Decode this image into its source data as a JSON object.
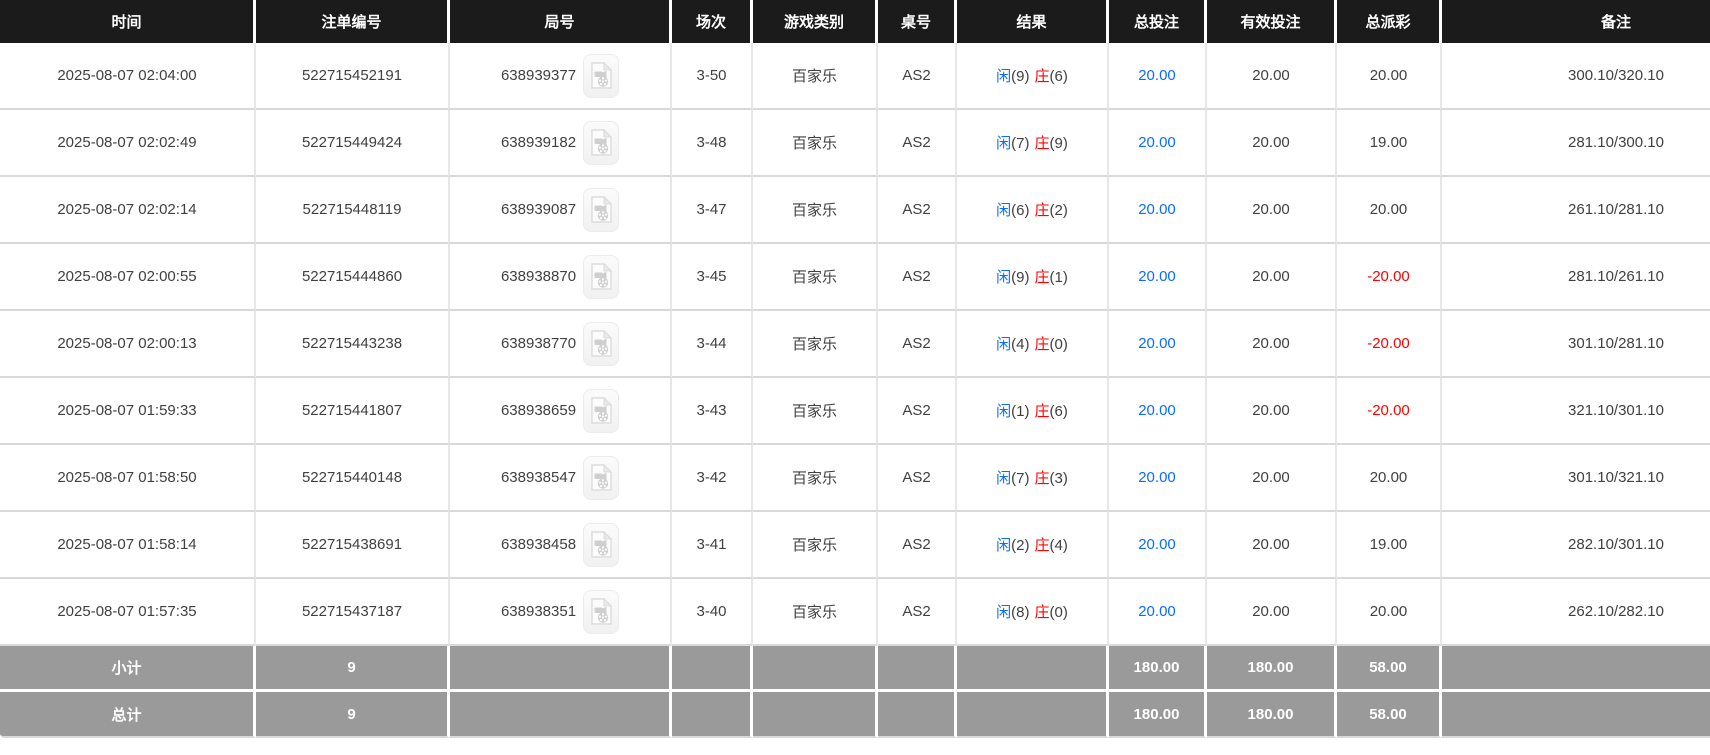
{
  "colors": {
    "header_bg": "#1b1b1b",
    "header_text": "#ffffff",
    "summary_bg": "#9a9a9a",
    "row_bg": "#ffffff",
    "text": "#404040",
    "blue_accent": "#0b6cff",
    "red_accent": "#ff0000",
    "grid_line": "#d9d9d9"
  },
  "table": {
    "headers": [
      "时间",
      "注单编号",
      "局号",
      "场次",
      "游戏类别",
      "桌号",
      "结果",
      "总投注",
      "有效投注",
      "总派彩",
      "备注"
    ],
    "rows": [
      {
        "time": "2025-08-07 02:04:00",
        "bet_no": "522715452191",
        "round_no": "638939377",
        "session": "3-50",
        "game": "百家乐",
        "table_no": "AS2",
        "player_label": "闲",
        "player_score": "(9)",
        "banker_label": "庄",
        "banker_score": "(6)",
        "total_bet": "20.00",
        "valid_bet": "20.00",
        "payout": "20.00",
        "remark": "300.10/320.10"
      },
      {
        "time": "2025-08-07 02:02:49",
        "bet_no": "522715449424",
        "round_no": "638939182",
        "session": "3-48",
        "game": "百家乐",
        "table_no": "AS2",
        "player_label": "闲",
        "player_score": "(7)",
        "banker_label": "庄",
        "banker_score": "(9)",
        "total_bet": "20.00",
        "valid_bet": "20.00",
        "payout": "19.00",
        "remark": "281.10/300.10"
      },
      {
        "time": "2025-08-07 02:02:14",
        "bet_no": "522715448119",
        "round_no": "638939087",
        "session": "3-47",
        "game": "百家乐",
        "table_no": "AS2",
        "player_label": "闲",
        "player_score": "(6)",
        "banker_label": "庄",
        "banker_score": "(2)",
        "total_bet": "20.00",
        "valid_bet": "20.00",
        "payout": "20.00",
        "remark": "261.10/281.10"
      },
      {
        "time": "2025-08-07 02:00:55",
        "bet_no": "522715444860",
        "round_no": "638938870",
        "session": "3-45",
        "game": "百家乐",
        "table_no": "AS2",
        "player_label": "闲",
        "player_score": "(9)",
        "banker_label": "庄",
        "banker_score": "(1)",
        "total_bet": "20.00",
        "valid_bet": "20.00",
        "payout": "-20.00",
        "remark": "281.10/261.10"
      },
      {
        "time": "2025-08-07 02:00:13",
        "bet_no": "522715443238",
        "round_no": "638938770",
        "session": "3-44",
        "game": "百家乐",
        "table_no": "AS2",
        "player_label": "闲",
        "player_score": "(4)",
        "banker_label": "庄",
        "banker_score": "(0)",
        "total_bet": "20.00",
        "valid_bet": "20.00",
        "payout": "-20.00",
        "remark": "301.10/281.10"
      },
      {
        "time": "2025-08-07 01:59:33",
        "bet_no": "522715441807",
        "round_no": "638938659",
        "session": "3-43",
        "game": "百家乐",
        "table_no": "AS2",
        "player_label": "闲",
        "player_score": "(1)",
        "banker_label": "庄",
        "banker_score": "(6)",
        "total_bet": "20.00",
        "valid_bet": "20.00",
        "payout": "-20.00",
        "remark": "321.10/301.10"
      },
      {
        "time": "2025-08-07 01:58:50",
        "bet_no": "522715440148",
        "round_no": "638938547",
        "session": "3-42",
        "game": "百家乐",
        "table_no": "AS2",
        "player_label": "闲",
        "player_score": "(7)",
        "banker_label": "庄",
        "banker_score": "(3)",
        "total_bet": "20.00",
        "valid_bet": "20.00",
        "payout": "20.00",
        "remark": "301.10/321.10"
      },
      {
        "time": "2025-08-07 01:58:14",
        "bet_no": "522715438691",
        "round_no": "638938458",
        "session": "3-41",
        "game": "百家乐",
        "table_no": "AS2",
        "player_label": "闲",
        "player_score": "(2)",
        "banker_label": "庄",
        "banker_score": "(4)",
        "total_bet": "20.00",
        "valid_bet": "20.00",
        "payout": "19.00",
        "remark": "282.10/301.10"
      },
      {
        "time": "2025-08-07 01:57:35",
        "bet_no": "522715437187",
        "round_no": "638938351",
        "session": "3-40",
        "game": "百家乐",
        "table_no": "AS2",
        "player_label": "闲",
        "player_score": "(8)",
        "banker_label": "庄",
        "banker_score": "(0)",
        "total_bet": "20.00",
        "valid_bet": "20.00",
        "payout": "20.00",
        "remark": "262.10/282.10"
      }
    ],
    "subtotal": {
      "label": "小计",
      "count": "9",
      "total_bet": "180.00",
      "valid_bet": "180.00",
      "payout": "58.00"
    },
    "grand_total": {
      "label": "总计",
      "count": "9",
      "total_bet": "180.00",
      "valid_bet": "180.00",
      "payout": "58.00"
    }
  },
  "icons": {
    "video": "video-file-icon"
  }
}
